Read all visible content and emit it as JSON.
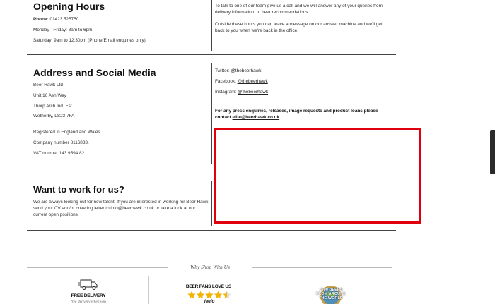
{
  "opening": {
    "title": "Opening Hours",
    "phone_label": "Phone:",
    "phone": "01423 525750",
    "weekday": "Monday - Friday: 8am to 6pm",
    "saturday": "Saturday: 9am to 12:30pm (Phone/Email enquiries only)",
    "right_p1": "To talk to one of our team give us a call and we will answer any of your queries from delivery information, to beer recommendations.",
    "right_p2": "Outside these hours you can leave a message on our answer machine and we'll get back to you when we're back in the office."
  },
  "address": {
    "title": "Address and Social Media",
    "lines": [
      "Beer Hawk Ltd",
      "Unit 16 Ash Way",
      "Thorp Arch Ind. Est.",
      "Wetherby, LS23 7FA"
    ],
    "registered": "Registered in England and Wales.",
    "company": "Company number 8116833.",
    "vat": "VAT number 143 9594 82.",
    "twitter_label": "Twitter:",
    "twitter_handle": "@thebeerhawk",
    "facebook_label": "Facebook:",
    "facebook_handle": "@thebeerhawk",
    "instagram_label": "Instagram:",
    "instagram_handle": "@thebeerhawk",
    "press_text": "For any press enquiries, releases, image requests and product loans please contact",
    "press_email": "ellie@beerhawk.co.uk"
  },
  "work": {
    "title": "Want to work for us?",
    "text": "We are always looking out for new talent. If you are interested in working for Beer Hawk send your CV and/or covering letter to info@beerhawk.co.uk or take a look at our current open positions."
  },
  "why": {
    "heading": "Why Shop With Us",
    "delivery_title": "FREE DELIVERY",
    "delivery_sub": "free delivery when you",
    "fans_title": "BEER FANS LOVE US",
    "fans_rating": 4.5,
    "fans_sub": "feefo",
    "beers_line1": "1000 BEERS",
    "beers_line2": "FROM AROUND",
    "beers_line3": "THE WORLD"
  },
  "colors": {
    "highlight": "#e0000d",
    "divider": "#444444",
    "star": "#f2b400"
  }
}
